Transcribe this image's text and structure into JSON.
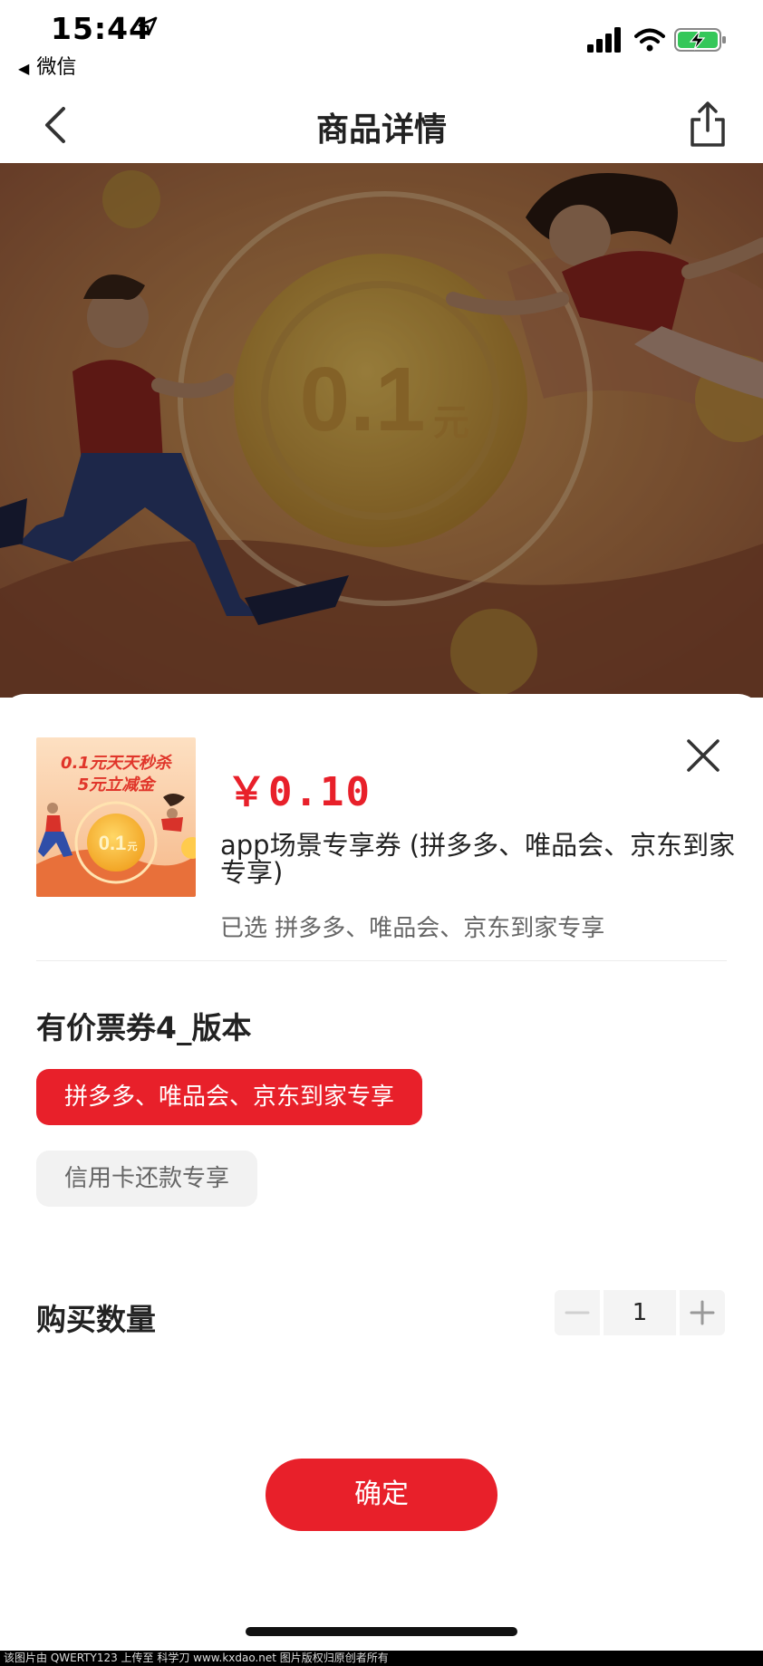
{
  "status_bar": {
    "time": "15:44",
    "back_app": "微信"
  },
  "nav": {
    "title": "商品详情"
  },
  "hero": {
    "coin_text": "0.1",
    "coin_unit": "元"
  },
  "product": {
    "thumb_title_line1": "0.1元天天秒杀",
    "thumb_title_line2": "5元立减金",
    "thumb_coin": "0.1",
    "thumb_coin_unit": "元",
    "price": "￥0.10",
    "name": "app场景专享券 (拼多多、唯品会、京东到家专享)",
    "selected": "已选 拼多多、唯品会、京东到家专享"
  },
  "spec": {
    "title": "有价票券4_版本",
    "options": [
      {
        "label": "拼多多、唯品会、京东到家专享",
        "selected": true
      },
      {
        "label": "信用卡还款专享",
        "selected": false
      }
    ]
  },
  "quantity": {
    "label": "购买数量",
    "value": "1"
  },
  "confirm": {
    "label": "确定"
  },
  "watermark": {
    "text": "该图片由 QWERTY123 上传至 科学刀 www.kxdao.net 图片版权归原创者所有"
  },
  "colors": {
    "accent": "#e8202a",
    "battery_green": "#34c759"
  }
}
